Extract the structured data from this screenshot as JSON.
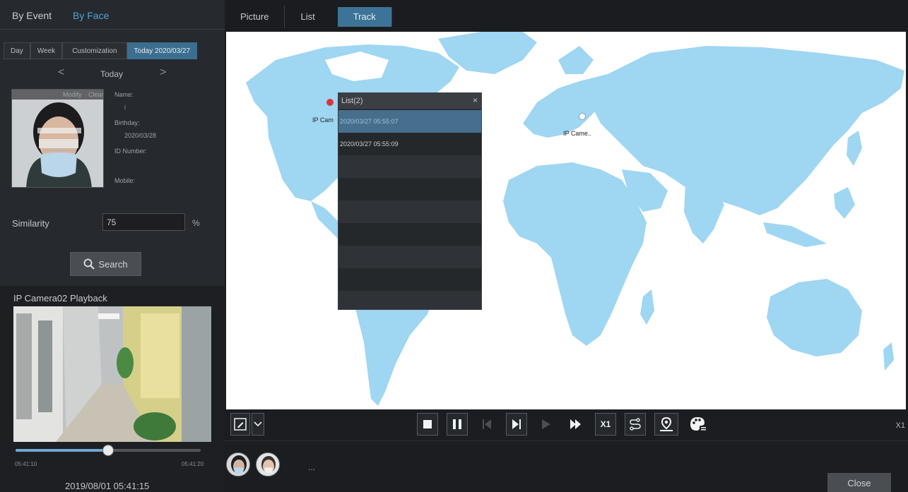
{
  "left_panel": {
    "mode_tabs": {
      "by_event": "By Event",
      "by_face": "By Face"
    },
    "range_tabs": {
      "day": "Day",
      "week": "Week",
      "customization": "Customization",
      "today": "Today 2020/03/27"
    },
    "date_nav": {
      "prev": "<",
      "label": "Today",
      "next": ">"
    },
    "face_card": {
      "modify": "Modify",
      "clear": "Clear"
    },
    "person": {
      "name_label": "Name:",
      "name_value": "i",
      "birthday_label": "Birthday:",
      "birthday_value": "2020/03/28",
      "id_label": "ID Number:",
      "mobile_label": "Mobile:"
    },
    "similarity": {
      "label": "Similarity",
      "value": "75",
      "unit": "%"
    },
    "search_button": "Search",
    "playback": {
      "title": "IP Camera02 Playback",
      "time_start": "05:41:10",
      "time_end": "05:41:20",
      "progress": 0.5,
      "datetime": "2019/08/01 05:41:15"
    }
  },
  "view_tabs": {
    "picture": "Picture",
    "list": "List",
    "track": "Track"
  },
  "map": {
    "camera_left": "IP Cam",
    "camera_right": "IP Came..",
    "land_color": "#9fd6f2",
    "list_popup": {
      "title": "List(2)",
      "close": "×",
      "rows": [
        "2020/03/27 05:55:07",
        "2020/03/27 05:55:09"
      ]
    }
  },
  "toolbar": {
    "speed_button": "X1",
    "speed_readout": "X1"
  },
  "bottom": {
    "more": "...",
    "close_button": "Close"
  }
}
